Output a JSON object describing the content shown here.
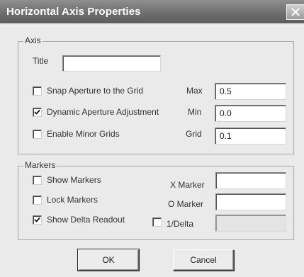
{
  "dialog": {
    "title": "Horizontal Axis Properties"
  },
  "axis": {
    "group_label": "Axis",
    "title_label": "Title",
    "title_value": "",
    "snap_label": "Snap Aperture to the Grid",
    "snap_checked": false,
    "dynamic_label": "Dynamic Aperture Adjustment",
    "dynamic_checked": true,
    "minor_label": "Enable Minor Grids",
    "minor_checked": false,
    "max_label": "Max",
    "max_value": "0.5",
    "min_label": "Min",
    "min_value": "0.0",
    "grid_label": "Grid",
    "grid_value": "0.1"
  },
  "markers": {
    "group_label": "Markers",
    "show_label": "Show Markers",
    "show_checked": false,
    "lock_label": "Lock Markers",
    "lock_checked": false,
    "delta_label": "Show Delta Readout",
    "delta_checked": true,
    "inv_delta_label": "1/Delta",
    "inv_delta_checked": false,
    "x_marker_label": "X Marker",
    "x_marker_value": "",
    "o_marker_label": "O Marker",
    "o_marker_value": "",
    "inv_delta_value": ""
  },
  "buttons": {
    "ok": "OK",
    "cancel": "Cancel"
  }
}
